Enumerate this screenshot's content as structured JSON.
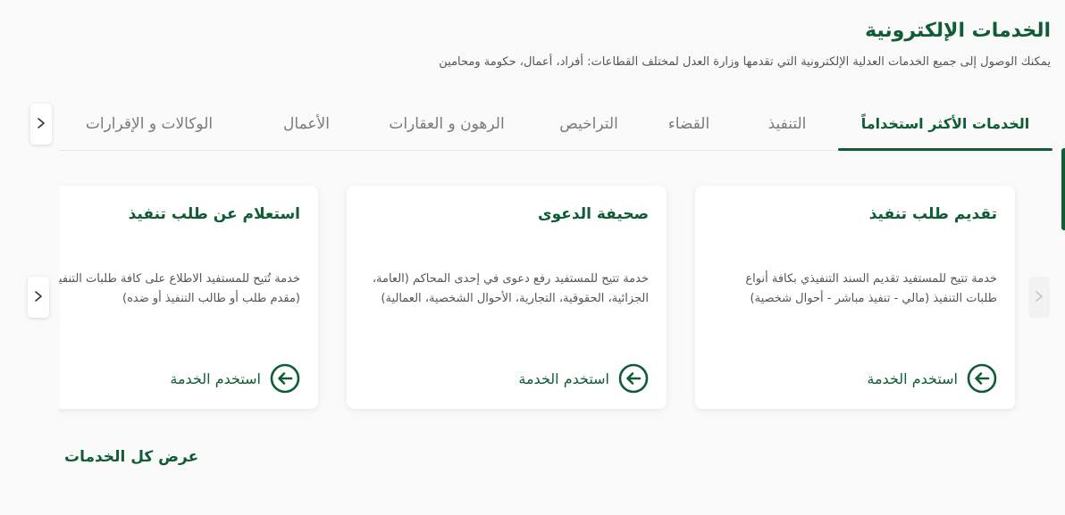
{
  "header": {
    "title": "الخدمات الإلكترونية",
    "subtitle": "يمكنك الوصول إلى جميع الخدمات العدلية الإلكترونية التي تقدمها وزارة العدل لمختلف القطاعات: أفراد، أعمال، حكومة ومحامين"
  },
  "tabs": [
    {
      "label": "الخدمات الأكثر استخداماً",
      "active": true
    },
    {
      "label": "التنفيذ",
      "active": false
    },
    {
      "label": "القضاء",
      "active": false
    },
    {
      "label": "التراخيص",
      "active": false
    },
    {
      "label": "الرهون و العقارات",
      "active": false
    },
    {
      "label": "الأعمال",
      "active": false
    },
    {
      "label": "الوكالات و الإقرارات",
      "active": false
    }
  ],
  "cards": [
    {
      "title": "تقديم طلب تنفيذ",
      "description": "خدمة تتيح للمستفيد تقديم السند التنفيذي بكافة أنواع طلبات التنفيذ (مالي - تنفيذ مباشر - أحوال شخصية)",
      "cta": "استخدم الخدمة"
    },
    {
      "title": "صحيفة الدعوى",
      "description": "خدمة تتيح للمستفيد رفع دعوى في إحدى المحاكم (العامة، الجزائية، الحقوقية، التجارية، الأحوال الشخصية، العمالية)",
      "cta": "استخدم الخدمة"
    },
    {
      "title": "استعلام عن طلب تنفيذ",
      "description": "خدمة تُتيح للمستفيد الاطلاع على كافة طلبات التنفيذ بصفته (مقدم طلب أو طالب التنفيذ أو ضده)",
      "cta": "استخدم الخدمة"
    }
  ],
  "footer": {
    "view_all": "عرض كل الخدمات"
  },
  "colors": {
    "primary": "#0f5c35",
    "muted_text": "#7b7b7b",
    "background": "#fafafa",
    "card_background": "#ffffff"
  },
  "icons": {
    "tabs_next": "chevron-right-icon",
    "carousel_next": "chevron-right-icon",
    "carousel_prev": "chevron-right-icon",
    "card_cta": "arrow-left-circle-icon"
  }
}
